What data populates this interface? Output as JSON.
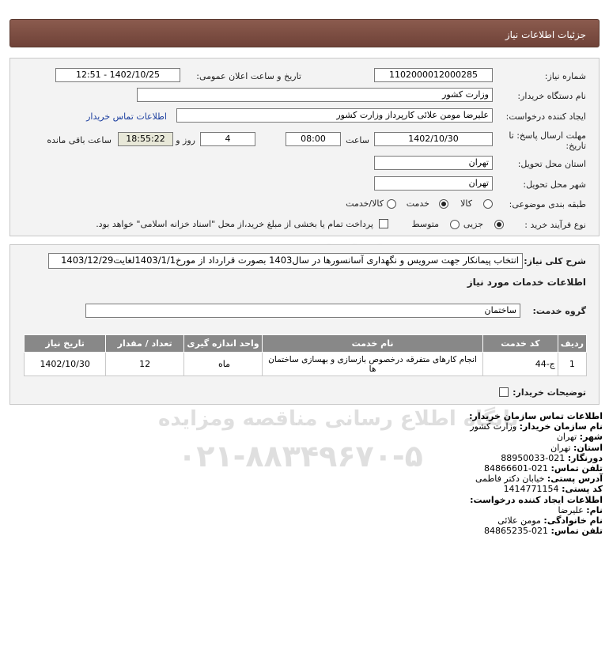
{
  "header": {
    "title": "جزئیات اطلاعات نیاز"
  },
  "form": {
    "need_number_label": "شماره نیاز:",
    "need_number": "1102000012000285",
    "announce_label": "تاریخ و ساعت اعلان عمومی:",
    "announce_value": "1402/10/25 - 12:51",
    "buyer_org_label": "نام دستگاه خریدار:",
    "buyer_org": "وزارت کشور",
    "creator_label": "ایجاد کننده درخواست:",
    "creator": "علیرضا مومن علائی کارپرداز وزارت کشور",
    "buyer_contact_link": "اطلاعات تماس خریدار",
    "deadline_label_1": "مهلت ارسال پاسخ: تا",
    "deadline_label_2": "تاریخ:",
    "deadline_date": "1402/10/30",
    "time_label": "ساعت",
    "deadline_time": "08:00",
    "days_value": "4",
    "days_label": "روز و",
    "remaining_time": "18:55:22",
    "remaining_label": "ساعت باقی مانده",
    "province_label": "استان محل تحویل:",
    "province": "تهران",
    "city_label": "شهر محل تحویل:",
    "city": "تهران",
    "category_label": "طبقه بندی موضوعی:",
    "category_options": [
      "کالا",
      "خدمت",
      "کالا/خدمت"
    ],
    "process_label": "نوع فرآیند خرید :",
    "process_options": [
      "جزیی",
      "متوسط"
    ],
    "payment_text": "پرداخت تمام یا بخشی از مبلغ خرید،از محل \"اسناد خزانه اسلامی\" خواهد بود."
  },
  "details": {
    "desc_label": "شرح کلی نیاز:",
    "description": "انتخاب پیمانکار جهت سرویس و نگهداری آسانسورها در سال1403 بصورت قرارداد از مورخ1403/1/1لغایت1403/12/29",
    "services_title": "اطلاعات خدمات مورد نیاز",
    "service_group_label": "گروه خدمت:",
    "service_group": "ساختمان",
    "table_headers": [
      "ردیف",
      "کد خدمت",
      "نام خدمت",
      "واحد اندازه گیری",
      "تعداد / مقدار",
      "تاریخ نیاز"
    ],
    "rows": [
      {
        "row": "1",
        "code": "ج-44",
        "name": "انجام کارهای متفرقه درخصوص بازسازی و بهسازی ساختمان ها",
        "unit": "ماه",
        "qty": "12",
        "date": "1402/10/30"
      }
    ],
    "buyer_notes_label": "توضیحات خریدار:"
  },
  "contact": {
    "org_title": "اطلاعات تماس سازمان خریدار:",
    "buyer_name_label": "نام سازمان خریدار:",
    "buyer_name": "وزارت کشور",
    "city_label": "شهر:",
    "city": "تهران",
    "province_label": "استان:",
    "province": "تهران",
    "fax_label": "دورنگار:",
    "fax": "021-88950033",
    "phone_label": "تلفن تماس:",
    "phone": "021-84866601",
    "address_label": "آدرس پستی:",
    "address": "خیابان دکتر فاطمی",
    "postal_label": "کد پستی:",
    "postal": "1414771154",
    "creator_title": "اطلاعات ایجاد کننده درخواست:",
    "first_name_label": "نام:",
    "first_name": "علیرضا",
    "last_name_label": "نام خانوادگی:",
    "last_name": "مومن علائی",
    "creator_phone_label": "تلفن تماس:",
    "creator_phone": "021-84865235"
  }
}
